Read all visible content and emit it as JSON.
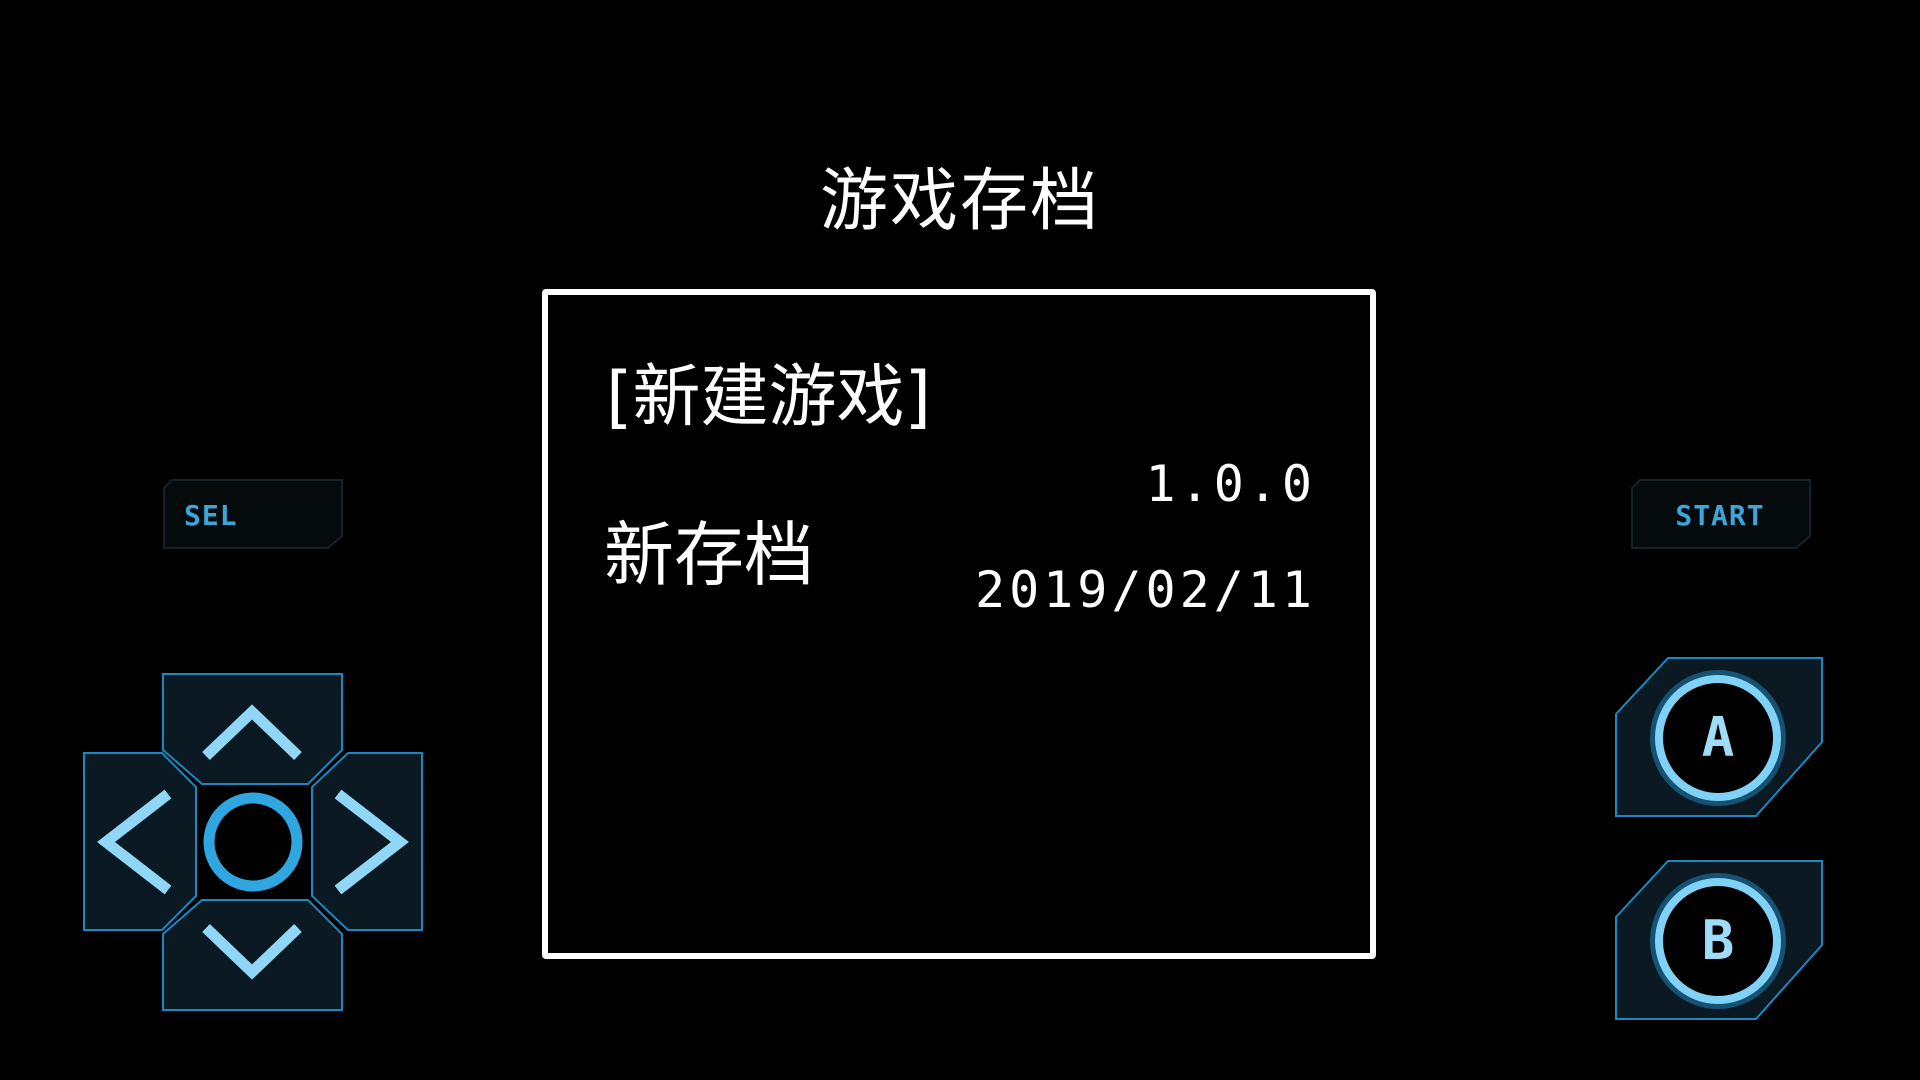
{
  "screen": {
    "title": "游戏存档"
  },
  "save_list": {
    "new_game_label": "[新建游戏]",
    "slots": [
      {
        "name": "新存档",
        "version": "1.0.0",
        "date": "2019/02/11"
      }
    ]
  },
  "controls": {
    "select_label": "SEL",
    "start_label": "START",
    "a_label": "A",
    "b_label": "B",
    "dpad": [
      "up",
      "down",
      "left",
      "right",
      "center"
    ]
  },
  "colors": {
    "background": "#000000",
    "text": "#ffffff",
    "control_fill": "#0b1a22",
    "control_stroke": "#1b88c2",
    "control_accent": "#52b9ee",
    "control_glow": "#9fe2ff"
  }
}
